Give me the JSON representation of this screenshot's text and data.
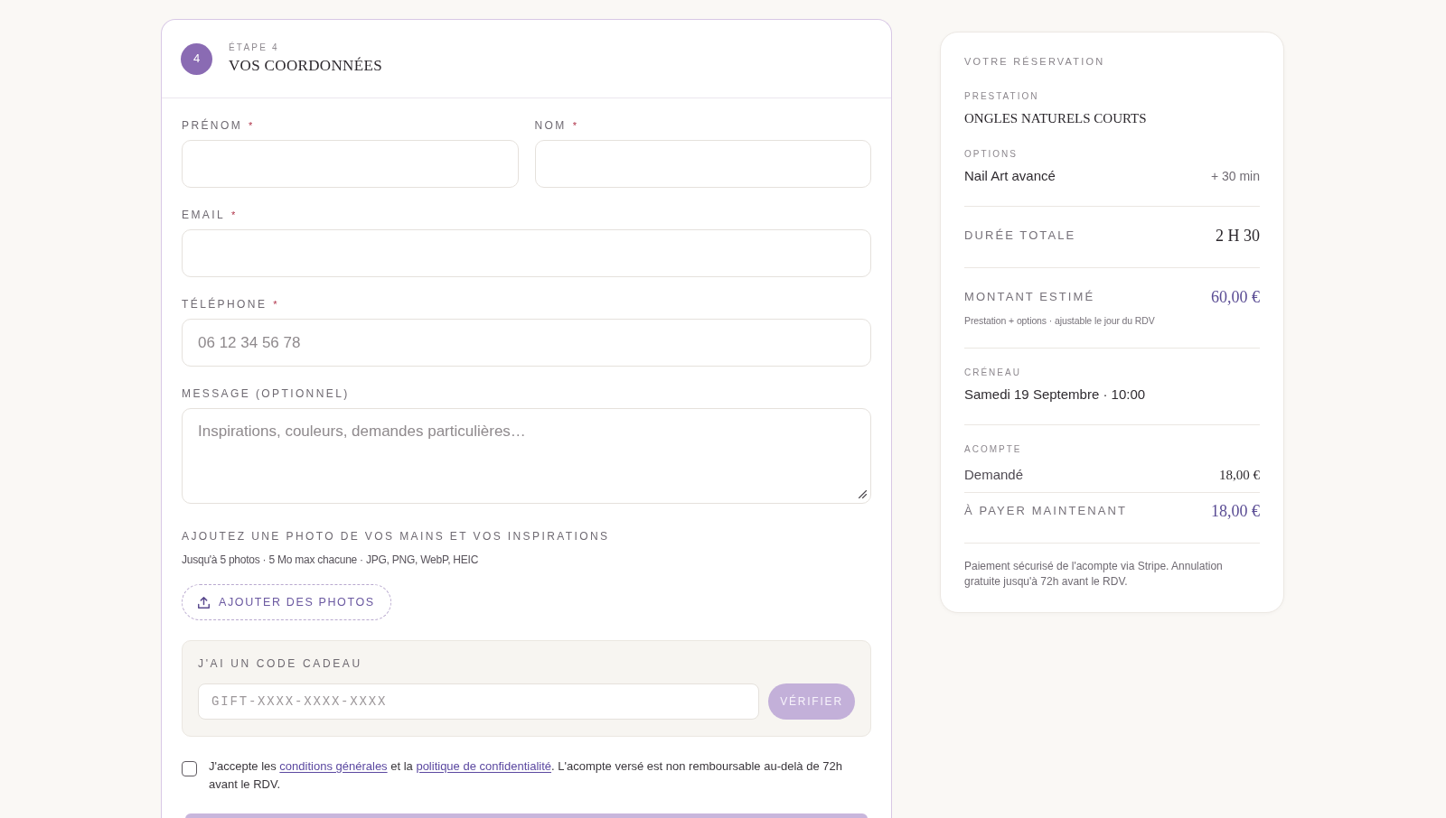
{
  "step": {
    "number": "4",
    "label": "ÉTAPE 4",
    "title": "VOS COORDONNÉES"
  },
  "form": {
    "rows": [
      [
        {
          "kind": "input",
          "label": "PRÉNOM",
          "required_mark": "*"
        },
        {
          "kind": "input",
          "label": "NOM",
          "required_mark": "*"
        }
      ],
      [
        {
          "kind": "input",
          "label": "EMAIL",
          "required_mark": "*"
        }
      ],
      [
        {
          "kind": "input",
          "label": "TÉLÉPHONE",
          "required_mark": "*",
          "placeholder": "06 12 34 56 78"
        }
      ],
      [
        {
          "kind": "textarea",
          "label": "MESSAGE (OPTIONNEL)",
          "placeholder": "Inspirations, couleurs, demandes particulières…"
        }
      ]
    ],
    "photos": {
      "title": "AJOUTEZ UNE PHOTO DE VOS MAINS ET VOS INSPIRATIONS",
      "hint": "Jusqu'à 5 photos · 5 Mo max chacune · JPG, PNG, WebP, HEIC",
      "button": "AJOUTER DES PHOTOS"
    },
    "gift_code": {
      "title": "J'AI UN CODE CADEAU",
      "placeholder": "GIFT-XXXX-XXXX-XXXX",
      "button": {
        "label": "VÉRIFIER",
        "disabled": true
      }
    },
    "consent": {
      "checked": false,
      "parts": [
        {
          "kind": "text",
          "text": "J'accepte les "
        },
        {
          "kind": "link",
          "text": "conditions générales"
        },
        {
          "kind": "text",
          "text": " et la "
        },
        {
          "kind": "link",
          "text": "politique de confidentialité"
        },
        {
          "kind": "text",
          "text": ". L'acompte versé est non remboursable au-delà de 72h avant le RDV."
        }
      ]
    },
    "submit_button": {
      "disabled": true
    }
  },
  "summary": {
    "title": "VOTRE RÉSERVATION",
    "groups": [
      {
        "items": [
          {
            "kind": "heading",
            "label": "PRESTATION",
            "value": "ONGLES NATURELS COURTS"
          },
          {
            "kind": "lines",
            "label": "OPTIONS",
            "lines": [
              {
                "name": "Nail Art avancé",
                "value": "+ 30 min"
              }
            ]
          }
        ]
      },
      {
        "items": [
          {
            "kind": "total",
            "label": "DURÉE TOTALE",
            "value": "2 H 30",
            "accent": false
          }
        ]
      },
      {
        "items": [
          {
            "kind": "total",
            "label": "MONTANT ESTIMÉ",
            "value": "60,00 €",
            "accent": true,
            "note": "Prestation + options · ajustable le jour du RDV"
          }
        ]
      },
      {
        "items": [
          {
            "kind": "text",
            "label": "CRÉNEAU",
            "value": "Samedi 19 Septembre · 10:00"
          }
        ]
      },
      {
        "items": [
          {
            "kind": "deposit",
            "label": "ACOMPTE",
            "lines": [
              {
                "name": "Demandé",
                "value": "18,00 €"
              }
            ],
            "due": {
              "label": "À PAYER MAINTENANT",
              "value": "18,00 €",
              "accent": true
            }
          }
        ]
      }
    ],
    "footnote": "Paiement sécurisé de l'acompte via Stripe. Annulation gratuite jusqu'à 72h avant le RDV."
  }
}
